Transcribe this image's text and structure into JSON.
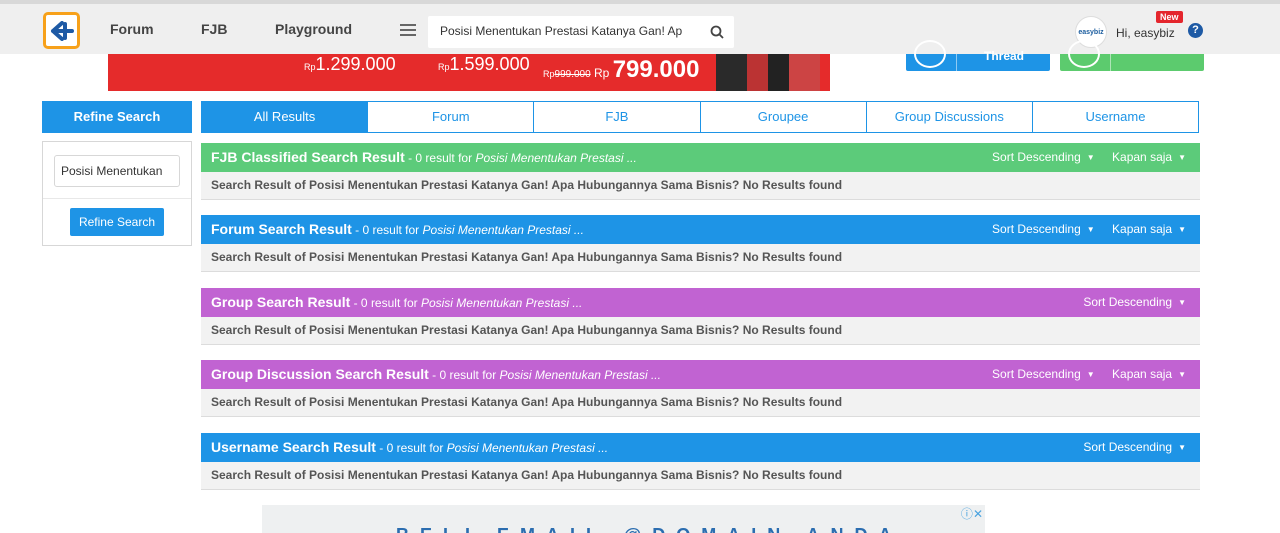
{
  "navbar": {
    "forum": "Forum",
    "fjb": "FJB",
    "playground": "Playground",
    "search_value": "Posisi Menentukan Prestasi Katanya Gan! Ap",
    "user_greeting": "Hi, easybiz",
    "new_badge": "New",
    "avatar_text": "easybiz"
  },
  "banner": {
    "price1_cur": "Rp",
    "price1": "1.299.000",
    "price2_cur": "Rp",
    "price2": "1.599.000",
    "price3_cur": "Rp",
    "price3_old": "999.000",
    "price3_new_cur": "Rp",
    "price3_new": "799.000",
    "thread_label": "Thread"
  },
  "sidebar": {
    "header": "Refine Search",
    "input_value": "Posisi Menentukan",
    "button": "Refine Search"
  },
  "tabs": [
    "All Results",
    "Forum",
    "FJB",
    "Groupee",
    "Group Discussions",
    "Username"
  ],
  "results": [
    {
      "title": "FJB Classified Search Result",
      "count": " - 0 result for ",
      "query": "Posisi Menentukan Prestasi ...",
      "sort": "Sort Descending",
      "time": "Kapan saja",
      "body": "Search Result of Posisi Menentukan Prestasi Katanya Gan! Apa Hubungannya Sama Bisnis? No Results found"
    },
    {
      "title": "Forum Search Result",
      "count": " - 0 result for ",
      "query": "Posisi Menentukan Prestasi ...",
      "sort": "Sort Descending",
      "time": "Kapan saja",
      "body": "Search Result of Posisi Menentukan Prestasi Katanya Gan! Apa Hubungannya Sama Bisnis? No Results found"
    },
    {
      "title": "Group Search Result",
      "count": " - 0 result for ",
      "query": "Posisi Menentukan Prestasi ...",
      "sort": "Sort Descending",
      "body": "Search Result of Posisi Menentukan Prestasi Katanya Gan! Apa Hubungannya Sama Bisnis? No Results found"
    },
    {
      "title": "Group Discussion Search Result",
      "count": " - 0 result for ",
      "query": "Posisi Menentukan Prestasi ...",
      "sort": "Sort Descending",
      "time": "Kapan saja",
      "body": "Search Result of Posisi Menentukan Prestasi Katanya Gan! Apa Hubungannya Sama Bisnis? No Results found"
    },
    {
      "title": "Username Search Result",
      "count": " - 0 result for ",
      "query": "Posisi Menentukan Prestasi ...",
      "sort": "Sort Descending",
      "body": "Search Result of Posisi Menentukan Prestasi Katanya Gan! Apa Hubungannya Sama Bisnis? No Results found"
    }
  ],
  "ad": {
    "text": "BELI EMAIL @DOMAIN ANDA"
  },
  "colors": {
    "brand_blue": "#1e94e6",
    "fjb_green": "#5ccb7a",
    "group_purple": "#c163d2",
    "banner_red": "#e52b2b",
    "logo_orange": "#f7a11a"
  },
  "icons": {
    "logo": "kaskus-logo-icon",
    "menu": "hamburger-menu-icon",
    "search": "search-icon",
    "help": "help-icon",
    "caret": "caret-down-icon",
    "ad_info": "ad-info-icon",
    "ad_close": "ad-close-icon"
  }
}
